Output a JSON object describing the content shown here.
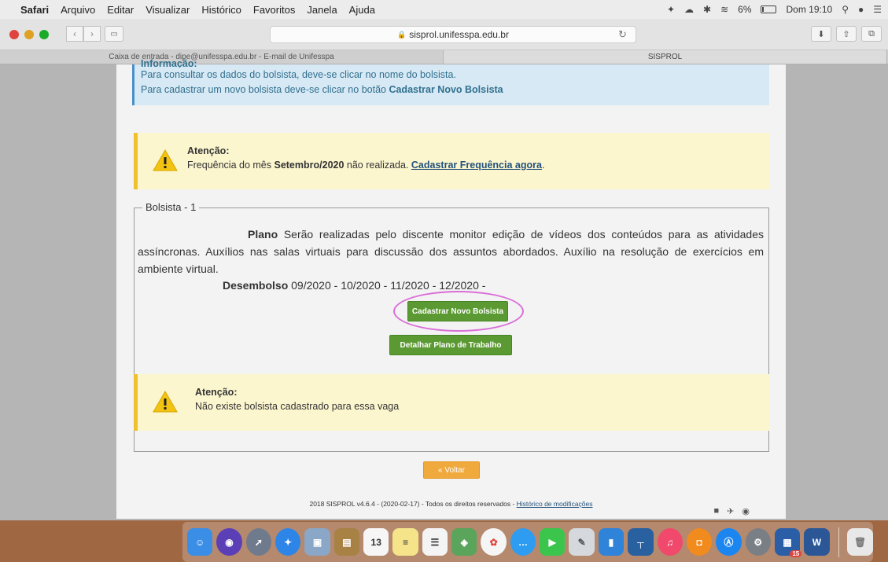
{
  "menubar": {
    "app": "Safari",
    "items": [
      "Arquivo",
      "Editar",
      "Visualizar",
      "Histórico",
      "Favoritos",
      "Janela",
      "Ajuda"
    ],
    "battery": "6%",
    "clock": "Dom 19:10"
  },
  "browser": {
    "url": "sisprol.unifesspa.edu.br",
    "tabs": [
      "Caixa de entrada - dipe@unifesspa.edu.br - E-mail de Unifesspa",
      "SISPROL"
    ]
  },
  "info": {
    "cut_heading": "Informação:",
    "line1": "Para consultar os dados do bolsista, deve-se clicar no nome do bolsista.",
    "line2_prefix": "Para cadastrar um novo bolsista deve-se clicar no botão ",
    "line2_bold": "Cadastrar Novo Bolsista"
  },
  "alert1": {
    "title": "Atenção:",
    "text_prefix": "Frequência do mês ",
    "month": "Setembro/2020",
    "text_suffix": " não realizada. ",
    "link": "Cadastrar Frequência agora",
    "end": "."
  },
  "bolsista": {
    "legend": "Bolsista - 1",
    "plan_label": "Plano",
    "plan_text": " Serão realizadas pelo discente monitor edição de vídeos dos conteúdos para as atividades assíncronas. Auxílios nas salas virtuais para discussão dos assuntos abordados. Auxílio na resolução de exercícios em ambiente virtual.",
    "desembolso_label": "Desembolso",
    "desembolso_value": " 09/2020 - 10/2020 - 11/2020 - 12/2020 -",
    "btn_cadastrar": "Cadastrar Novo Bolsista",
    "btn_detalhar": "Detalhar Plano de Trabalho"
  },
  "alert2": {
    "title": "Atenção:",
    "text": "Não existe bolsista cadastrado para essa vaga"
  },
  "voltar": "« Voltar",
  "footer": {
    "text": "2018 SISPROL v4.6.4 - (2020-02-17) - Todos os direitos reservados - ",
    "link": "Histórico de modificações"
  },
  "dock": {
    "calendar_day": "13",
    "word_label": "W",
    "badge": "15"
  }
}
